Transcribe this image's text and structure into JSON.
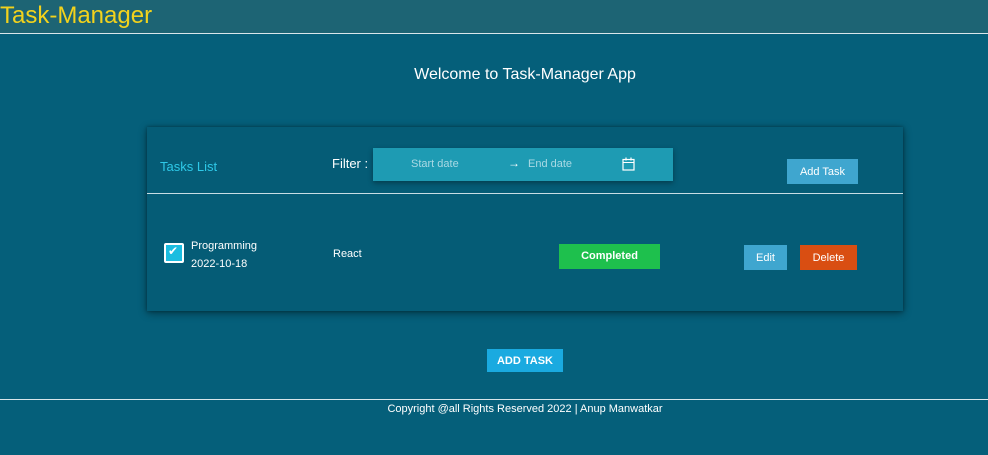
{
  "app": {
    "brand": "Task-Manager",
    "welcome": "Welcome to Task-Manager App"
  },
  "tasks_panel": {
    "title": "Tasks List",
    "filter_label": "Filter :",
    "date_range": {
      "start_placeholder": "Start date",
      "end_placeholder": "End date",
      "separator_icon": "arrow-right-icon",
      "picker_icon": "calendar-icon"
    },
    "add_task_label": "Add Task"
  },
  "tasks": [
    {
      "name": "Programming",
      "date": "2022-10-18",
      "tag": "React",
      "status": "Completed",
      "checked": true,
      "edit_label": "Edit",
      "delete_label": "Delete"
    }
  ],
  "main_add_task_label": "ADD TASK",
  "footer": {
    "copyright": "Copyright @all Rights Reserved 2022 | Anup Manwatkar"
  },
  "colors": {
    "background": "#055f7a",
    "brand": "#f2d21c",
    "accent": "#2ec9e8",
    "completed": "#1ec04d",
    "delete": "#d94e12",
    "button": "#3fa6cf"
  }
}
